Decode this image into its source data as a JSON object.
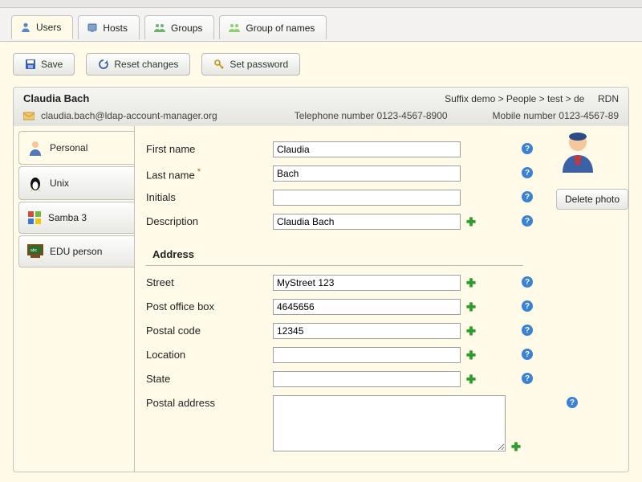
{
  "nav": {
    "tabs": [
      {
        "label": "Users",
        "active": true
      },
      {
        "label": "Hosts",
        "active": false
      },
      {
        "label": "Groups",
        "active": false
      },
      {
        "label": "Group of names",
        "active": false
      }
    ]
  },
  "actions": {
    "save": "Save",
    "reset": "Reset changes",
    "set_password": "Set password"
  },
  "header": {
    "title": "Claudia Bach",
    "suffix_text": "Suffix demo > People > test > de",
    "rdn_label": "RDN",
    "email": "claudia.bach@ldap-account-manager.org",
    "phone_label": "Telephone number",
    "phone_value": "0123-4567-8900",
    "mobile_label": "Mobile number",
    "mobile_value": "0123-4567-89"
  },
  "side_tabs": [
    {
      "label": "Personal",
      "active": true
    },
    {
      "label": "Unix",
      "active": false
    },
    {
      "label": "Samba 3",
      "active": false
    },
    {
      "label": "EDU person",
      "active": false
    }
  ],
  "form": {
    "first_name": {
      "label": "First name",
      "value": "Claudia"
    },
    "last_name": {
      "label": "Last name",
      "value": "Bach",
      "required": true
    },
    "initials": {
      "label": "Initials",
      "value": ""
    },
    "description": {
      "label": "Description",
      "value": "Claudia Bach"
    },
    "address_heading": "Address",
    "street": {
      "label": "Street",
      "value": "MyStreet 123"
    },
    "pobox": {
      "label": "Post office box",
      "value": "4645656"
    },
    "postal_code": {
      "label": "Postal code",
      "value": "12345"
    },
    "location": {
      "label": "Location",
      "value": ""
    },
    "state": {
      "label": "State",
      "value": ""
    },
    "postal_address": {
      "label": "Postal address",
      "value": ""
    }
  },
  "photo": {
    "delete_label": "Delete photo"
  }
}
